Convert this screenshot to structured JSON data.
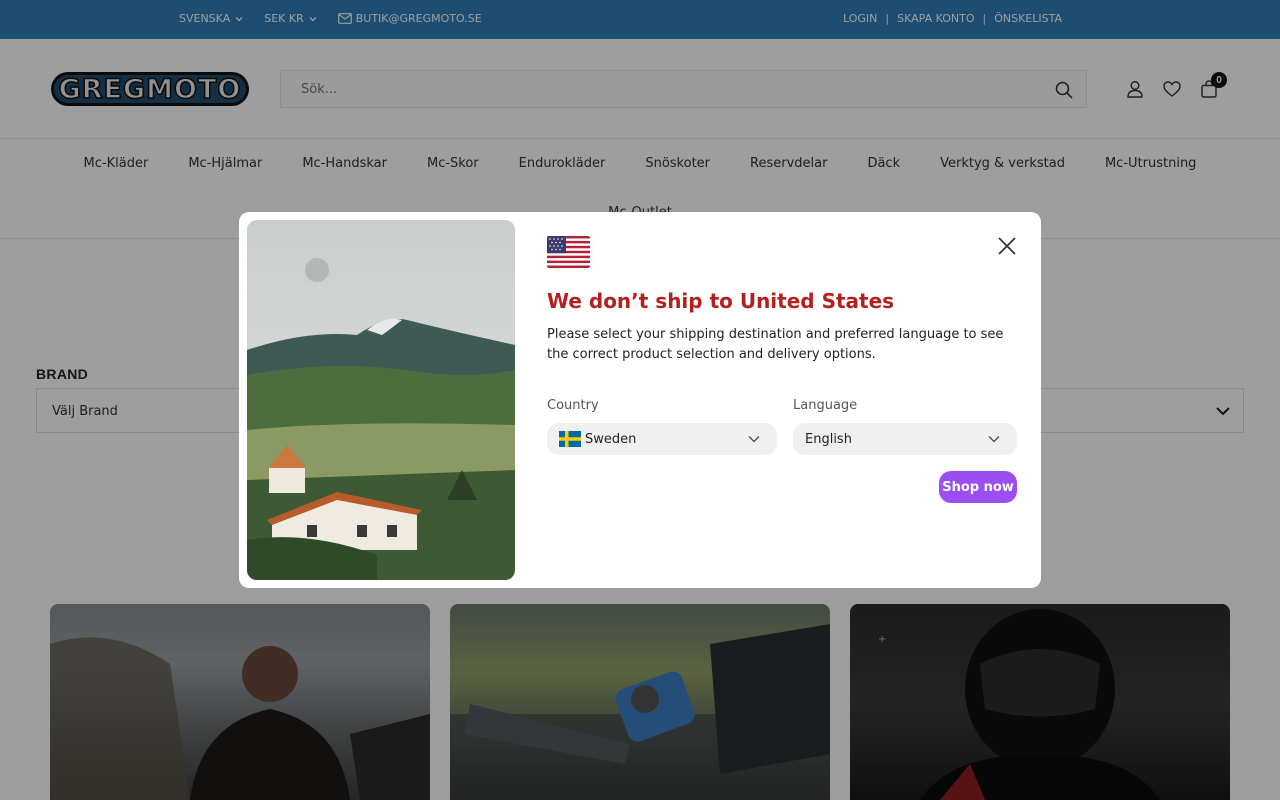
{
  "topbar": {
    "language": "SVENSKA",
    "currency": "SEK KR",
    "email": "BUTIK@GREGMOTO.SE",
    "login": "LOGIN",
    "create_account": "SKAPA KONTO",
    "wishlist": "ÖNSKELISTA",
    "separator": "|",
    "bg_color": "#2f7fb8"
  },
  "header": {
    "logo_text": "GREGMOTO",
    "search_placeholder": "Sök...",
    "cart_count": "0"
  },
  "nav": {
    "items": [
      "Mc-Kläder",
      "Mc-Hjälmar",
      "Mc-Handskar",
      "Mc-Skor",
      "Endurokläder",
      "Snöskoter",
      "Reservdelar",
      "Däck",
      "Verktyg & verkstad",
      "Mc-Utrustning"
    ],
    "row2_item": "Mc-Outlet"
  },
  "filters": {
    "brand_label": "BRAND",
    "brand_value": "Välj Brand"
  },
  "modal": {
    "title": "We don’t ship to United States",
    "description": "Please select your shipping destination and preferred language to see the correct product selection and delivery options.",
    "country_label": "Country",
    "country_value": "Sweden",
    "language_label": "Language",
    "language_value": "English",
    "cta": "Shop now",
    "title_color": "#b3211e",
    "cta_color": "#9b4ff0"
  }
}
